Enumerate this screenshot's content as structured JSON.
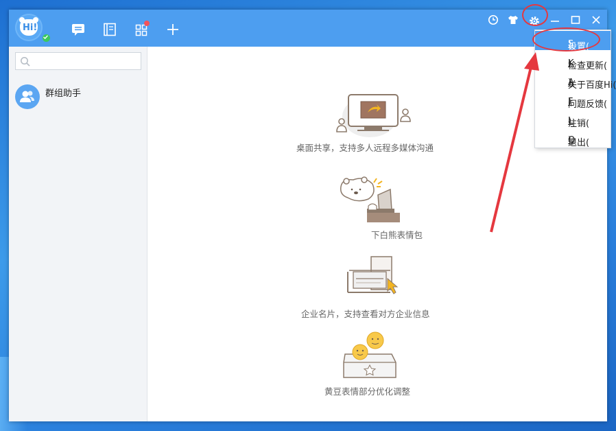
{
  "app": {
    "avatar_text": "Hi!",
    "status": "online"
  },
  "nav": {
    "icons": [
      "chat-icon",
      "contacts-book-icon",
      "apps-grid-icon",
      "plus-icon"
    ],
    "apps_has_badge": true
  },
  "titlebar": {
    "icons": [
      "history-icon",
      "skin-shirt-icon",
      "gear-icon",
      "minimize-icon",
      "maximize-icon",
      "close-icon"
    ]
  },
  "sidebar": {
    "search_placeholder": "",
    "contacts": [
      {
        "name": "群组助手"
      }
    ]
  },
  "features": [
    {
      "caption": "桌面共享，支持多人远程多媒体沟通"
    },
    {
      "caption": "下白熊表情包"
    },
    {
      "caption": "企业名片，支持查看对方企业信息"
    },
    {
      "caption": "黄豆表情部分优化调整"
    }
  ],
  "menu": {
    "items": [
      {
        "label": "设置(",
        "accel": "S",
        "tail": ")",
        "selected": true
      },
      {
        "label": "检查更新(",
        "accel": "K",
        "tail": ")",
        "selected": false
      },
      {
        "label": "关于百度Hi(",
        "accel": "A",
        "tail": ")",
        "selected": false
      },
      {
        "label": "问题反馈(",
        "accel": "F",
        "tail": ")",
        "selected": false
      },
      {
        "label": "注销(",
        "accel": "L",
        "tail": ")",
        "selected": false
      },
      {
        "label": "退出(",
        "accel": "Q",
        "tail": ")",
        "selected": false
      }
    ]
  },
  "colors": {
    "titlebar": "#4d9ef0",
    "menu_selected": "#4d9ef0",
    "annotation_red": "#e5383f",
    "sidebar_bg": "#f2f4f7"
  }
}
